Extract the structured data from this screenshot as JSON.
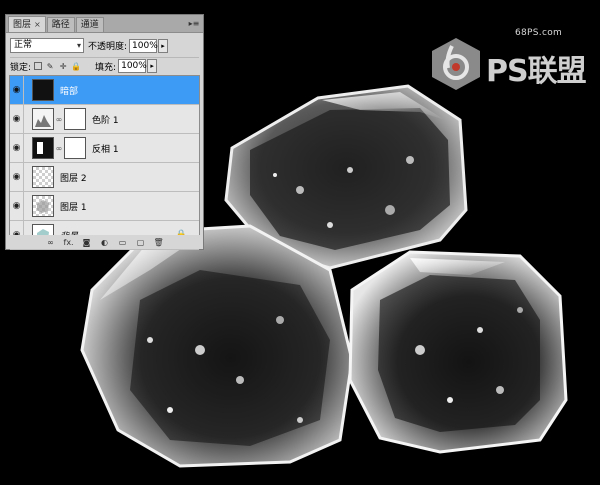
{
  "panel": {
    "tabs": [
      {
        "label": "图层",
        "close": "×",
        "active": true
      },
      {
        "label": "路径",
        "active": false
      },
      {
        "label": "通道",
        "active": false
      }
    ],
    "blend_mode": "正常",
    "opacity_label": "不透明度:",
    "opacity_value": "100%",
    "lock_label": "锁定:",
    "fill_label": "填充:",
    "fill_value": "100%",
    "layers": [
      {
        "name": "暗部",
        "selected": true,
        "thumb": "dark",
        "mask": false
      },
      {
        "name": "色阶 1",
        "selected": false,
        "thumb": "levels",
        "mask": true
      },
      {
        "name": "反相 1",
        "selected": false,
        "thumb": "invert",
        "mask": true
      },
      {
        "name": "图层 2",
        "selected": false,
        "thumb": "transparent",
        "mask": false
      },
      {
        "name": "图层 1",
        "selected": false,
        "thumb": "transparent-ice",
        "mask": false
      },
      {
        "name": "背景",
        "selected": false,
        "thumb": "background",
        "mask": false,
        "locked": true
      }
    ],
    "bottom_icons": [
      "link-icon",
      "fx-icon",
      "mask-icon",
      "adjustment-icon",
      "group-icon",
      "new-layer-icon",
      "trash-icon"
    ],
    "fx_label": "fx."
  },
  "watermark": {
    "site": "68PS.com",
    "brand": "PS联盟"
  },
  "colors": {
    "selection": "#3d9af5",
    "panel_bg": "#d6d6d6",
    "canvas_bg": "#000000"
  }
}
